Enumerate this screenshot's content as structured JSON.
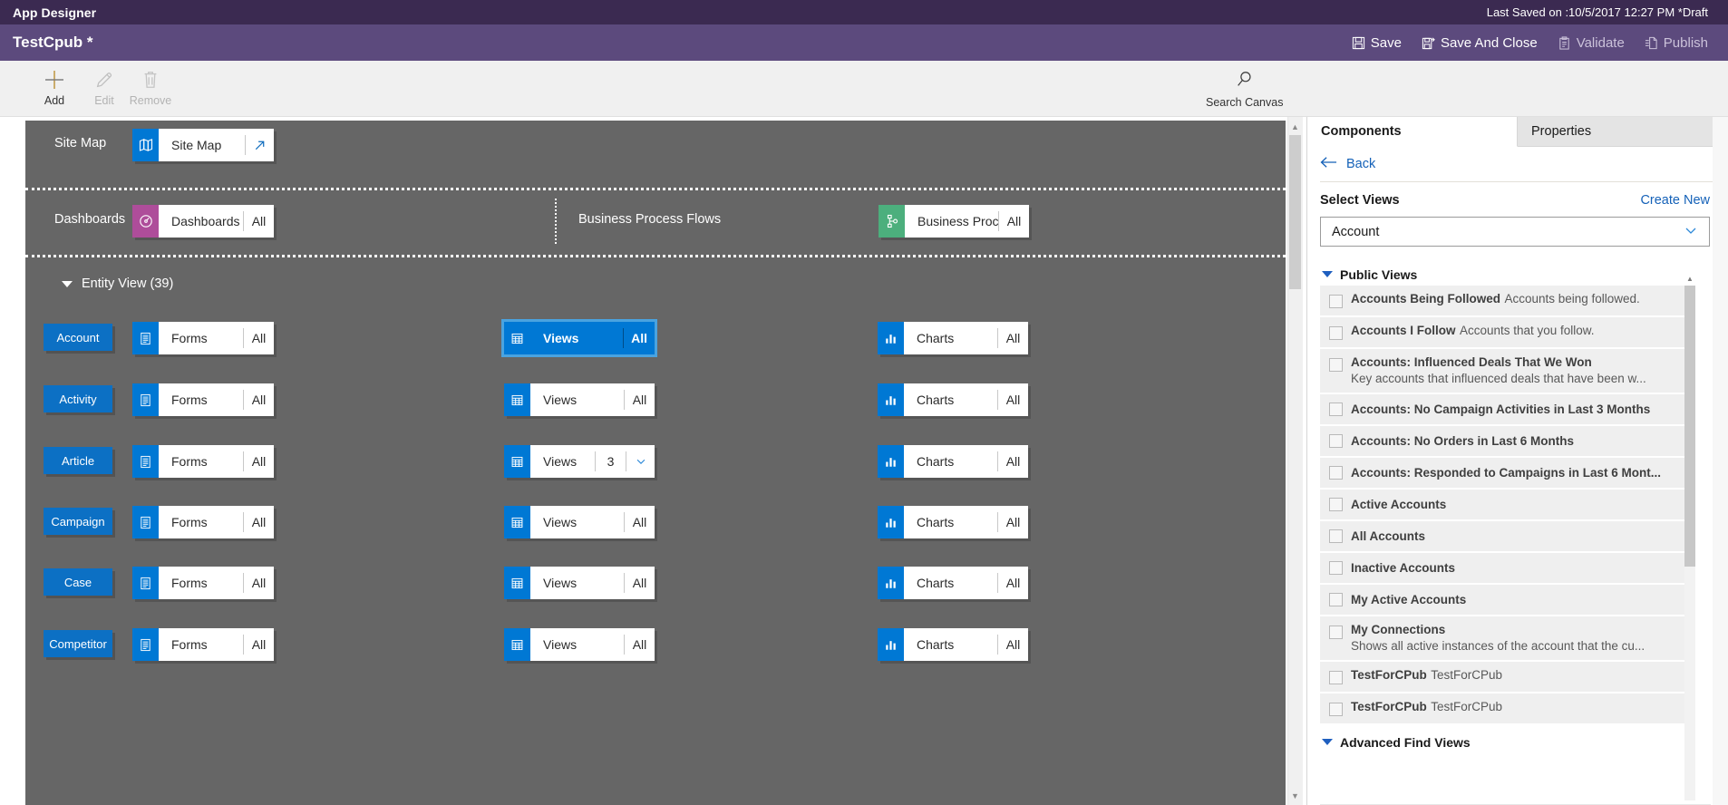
{
  "titlebar": {
    "title": "App Designer",
    "last_saved": "Last Saved on :10/5/2017 12:27 PM *Draft"
  },
  "appbar": {
    "app_name": "TestCpub *",
    "actions": [
      {
        "label": "Save",
        "icon": "save-icon",
        "enabled": true
      },
      {
        "label": "Save And Close",
        "icon": "save-and-close-icon",
        "enabled": true
      },
      {
        "label": "Validate",
        "icon": "validate-icon",
        "enabled": false
      },
      {
        "label": "Publish",
        "icon": "publish-icon",
        "enabled": false
      }
    ]
  },
  "commandbar": {
    "add": {
      "label": "Add",
      "icon": "plus-icon"
    },
    "edit": {
      "label": "Edit",
      "icon": "pencil-icon"
    },
    "remove": {
      "label": "Remove",
      "icon": "trash-icon"
    },
    "search": {
      "label": "Search Canvas",
      "icon": "search-icon"
    }
  },
  "canvas": {
    "sitemap_row": {
      "label": "Site Map",
      "tile": {
        "label": "Site Map",
        "icon": "map-icon",
        "icon_color": "#0078d4",
        "action": "open-arrow"
      }
    },
    "dashboards_row": {
      "label": "Dashboards",
      "tile": {
        "label": "Dashboards",
        "count": "All",
        "icon": "dashboard-icon",
        "icon_color": "#ae4d9a"
      }
    },
    "bpf_row": {
      "label": "Business Process Flows",
      "tile": {
        "label": "Business Proces...",
        "count": "All",
        "icon": "process-flow-icon",
        "icon_color": "#4caf7d"
      }
    },
    "entity_section": {
      "label": "Entity View (39)",
      "columns": [
        "Forms",
        "Views",
        "Charts"
      ],
      "rows": [
        {
          "entity": "Account",
          "forms": {
            "label": "Forms",
            "count": "All"
          },
          "views": {
            "label": "Views",
            "count": "All",
            "selected": true
          },
          "charts": {
            "label": "Charts",
            "count": "All"
          }
        },
        {
          "entity": "Activity",
          "forms": {
            "label": "Forms",
            "count": "All"
          },
          "views": {
            "label": "Views",
            "count": "All",
            "selected": false
          },
          "charts": {
            "label": "Charts",
            "count": "All"
          }
        },
        {
          "entity": "Article",
          "forms": {
            "label": "Forms",
            "count": "All"
          },
          "views": {
            "label": "Views",
            "count": "3",
            "selected": false,
            "has_chevron": true
          },
          "charts": {
            "label": "Charts",
            "count": "All"
          }
        },
        {
          "entity": "Campaign",
          "forms": {
            "label": "Forms",
            "count": "All"
          },
          "views": {
            "label": "Views",
            "count": "All",
            "selected": false
          },
          "charts": {
            "label": "Charts",
            "count": "All"
          }
        },
        {
          "entity": "Case",
          "forms": {
            "label": "Forms",
            "count": "All"
          },
          "views": {
            "label": "Views",
            "count": "All",
            "selected": false
          },
          "charts": {
            "label": "Charts",
            "count": "All"
          }
        },
        {
          "entity": "Competitor",
          "forms": {
            "label": "Forms",
            "count": "All"
          },
          "views": {
            "label": "Views",
            "count": "All",
            "selected": false
          },
          "charts": {
            "label": "Charts",
            "count": "All"
          }
        }
      ]
    }
  },
  "right_panel": {
    "tabs": [
      {
        "label": "Components",
        "active": true
      },
      {
        "label": "Properties",
        "active": false
      }
    ],
    "back_label": "Back",
    "select_title": "Select Views",
    "create_new_label": "Create New",
    "entity_select_value": "Account",
    "groups": [
      {
        "label": "Public Views",
        "expanded": true
      },
      {
        "label": "Advanced Find Views",
        "expanded": true
      }
    ],
    "views": [
      {
        "name": "Accounts Being Followed",
        "desc": "Accounts being followed.",
        "checked": false
      },
      {
        "name": "Accounts I Follow",
        "desc": "Accounts that you follow.",
        "checked": false
      },
      {
        "name": "Accounts: Influenced Deals That We Won",
        "desc": "Key accounts that influenced deals that have been w...",
        "checked": false
      },
      {
        "name": "Accounts: No Campaign Activities in Last 3 Months",
        "desc": "",
        "checked": false
      },
      {
        "name": "Accounts: No Orders in Last 6 Months",
        "desc": "",
        "checked": false
      },
      {
        "name": "Accounts: Responded to Campaigns in Last 6 Mont...",
        "desc": "",
        "checked": false
      },
      {
        "name": "Active Accounts",
        "desc": "",
        "checked": false
      },
      {
        "name": "All Accounts",
        "desc": "",
        "checked": false
      },
      {
        "name": "Inactive Accounts",
        "desc": "",
        "checked": false
      },
      {
        "name": "My Active Accounts",
        "desc": "",
        "checked": false
      },
      {
        "name": "My Connections",
        "desc": "Shows all active instances of the account that the cu...",
        "checked": false
      },
      {
        "name": "TestForCPub",
        "desc": "TestForCPub",
        "checked": false
      },
      {
        "name": "TestForCPub",
        "desc": "TestForCPub",
        "checked": false
      }
    ]
  },
  "colors": {
    "titlebar_bg": "#3b2a51",
    "appbar_bg": "#5c4a7d",
    "canvas_bg": "#666666",
    "accent_blue": "#0078d4",
    "entity_blue": "#0c70c4",
    "dashboard_purple": "#ae4d9a",
    "bpf_green": "#4caf7d",
    "link_blue": "#1461b8"
  }
}
